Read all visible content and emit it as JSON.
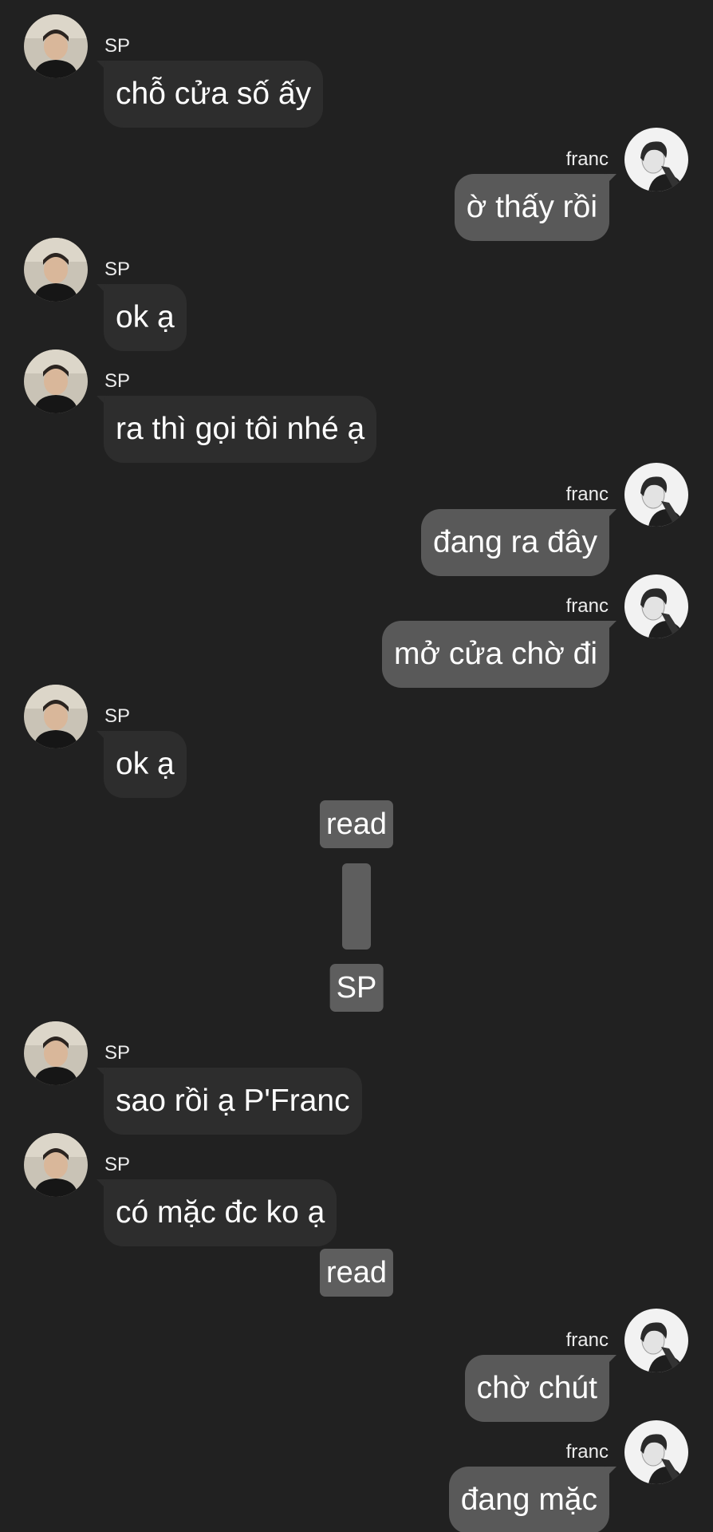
{
  "chat": {
    "messages": [
      {
        "side": "left",
        "sender": "SP",
        "text": "chỗ cửa số ấy"
      },
      {
        "side": "right",
        "sender": "franc",
        "text": "ờ thấy rồi"
      },
      {
        "side": "left",
        "sender": "SP",
        "text": "ok ạ"
      },
      {
        "side": "left",
        "sender": "SP",
        "text": "ra thì gọi tôi nhé ạ"
      },
      {
        "side": "right",
        "sender": "franc",
        "text": "đang ra đây"
      },
      {
        "side": "right",
        "sender": "franc",
        "text": "mở cửa chờ đi"
      },
      {
        "side": "left",
        "sender": "SP",
        "text": "ok ạ"
      },
      {
        "side": "left",
        "sender": "SP",
        "text": "sao rồi ạ P'Franc"
      },
      {
        "side": "left",
        "sender": "SP",
        "text": "có mặc đc ko ạ"
      },
      {
        "side": "right",
        "sender": "franc",
        "text": "chờ chút"
      },
      {
        "side": "right",
        "sender": "franc",
        "text": "đang mặc"
      }
    ],
    "read_label": "read",
    "sp_chip_label": "SP"
  },
  "colors": {
    "background": "#212121",
    "bubble_left": "#2d2d2d",
    "bubble_right": "#595959",
    "chip": "#5e5e5e"
  },
  "icons": {
    "sp_avatar": "avatar-photo-sp",
    "franc_avatar": "avatar-photo-franc"
  }
}
